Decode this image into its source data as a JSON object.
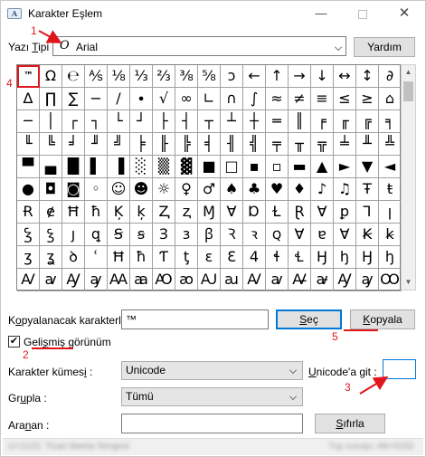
{
  "window": {
    "title": "Karakter Eşlem",
    "app_icon": "A"
  },
  "titlebar": {
    "minimize": "—",
    "close": "✕"
  },
  "font_row": {
    "label_pre": "Yazı ",
    "label_u": "T",
    "label_post": "ipi :",
    "value": "Arial",
    "font_icon": "O",
    "help": "Yardım"
  },
  "grid": {
    "selected": "™",
    "rows": [
      [
        "™",
        "Ω",
        "℮",
        "⅍",
        "⅛",
        "⅓",
        "⅔",
        "⅜",
        "⅝",
        "ↄ",
        "←",
        "↑",
        "→",
        "↓",
        "↔",
        "↕",
        "∂"
      ],
      [
        "∆",
        "∏",
        "∑",
        "−",
        "∕",
        "∙",
        "√",
        "∞",
        "∟",
        "∩",
        "∫",
        "≈",
        "≠",
        "≡",
        "≤",
        "≥",
        "⌂"
      ],
      [
        "─",
        "│",
        "┌",
        "┐",
        "└",
        "┘",
        "├",
        "┤",
        "┬",
        "┴",
        "┼",
        "═",
        "║",
        "╒",
        "╓",
        "╔",
        "╕"
      ],
      [
        "╙",
        "╚",
        "╛",
        "╜",
        "╝",
        "╞",
        "╟",
        "╠",
        "╡",
        "╢",
        "╣",
        "╤",
        "╥",
        "╦",
        "╧",
        "╨",
        "╩"
      ],
      [
        "▀",
        "▄",
        "█",
        "▌",
        "▐",
        "░",
        "▒",
        "▓",
        "■",
        "□",
        "▪",
        "▫",
        "▬",
        "▲",
        "►",
        "▼",
        "◄"
      ],
      [
        "●",
        "◘",
        "◙",
        "◦",
        "☺",
        "☻",
        "☼",
        "♀",
        "♂",
        "♠",
        "♣",
        "♥",
        "♦",
        "♪",
        "♫",
        "Ŧ",
        "ŧ"
      ],
      [
        "Ɍ",
        "ɇ",
        "Ħ",
        "ħ",
        "Ķ",
        "ķ",
        "Ⱬ",
        "ⱬ",
        "Ɱ",
        "Ɐ",
        "Ɒ",
        "Ɫ",
        "Ɽ",
        "Ɐ",
        "ꝑ",
        "Ꞁ",
        "ꞁ"
      ],
      [
        "Ꝣ",
        "ꝣ",
        "ȷ",
        "ꝗ",
        "Ꞩ",
        "ꞩ",
        "Ɜ",
        "ɜ",
        "ꞵ",
        "Ꝛ",
        "ꝛ",
        "ꞯ",
        "Ɐ",
        "ɐ",
        "Ɐ",
        "Ꞣ",
        "ꞣ"
      ],
      [
        "ʒ",
        "ʓ",
        "ꝺ",
        "ʿ",
        "Ħ",
        "ħ",
        "Ƭ",
        "ƫ",
        "ɛ",
        "Ɛ",
        "4",
        "ɬ",
        "Ɬ",
        "Ꜧ",
        "ꜧ",
        "Ꜧ",
        "ꜧ"
      ],
      [
        "Ꜹ",
        "ꜹ",
        "Ꜽ",
        "ꜽ",
        "Ꜳ",
        "ꜳ",
        "Ꜵ",
        "ꜵ",
        "Ꜷ",
        "ꜷ",
        "Ꜹ",
        "ꜹ",
        "Ꜻ",
        "ꜻ",
        "Ꜽ",
        "ꜽ",
        "Ꝏ"
      ]
    ]
  },
  "copy_row": {
    "label_pre": "K",
    "label_u": "o",
    "label_post": "pyalanacak karakterler :",
    "value": "™",
    "select_pre": "",
    "select_u": "S",
    "select_post": "eç",
    "copy_pre": "",
    "copy_u": "K",
    "copy_post": "opyala"
  },
  "advanced": {
    "checked": "✔",
    "label_pre": "Geli",
    "label_u": "ş",
    "label_post": "miş görünüm"
  },
  "charset": {
    "label_pre": "Karakter kümes",
    "label_u": "i",
    "label_post": " :",
    "value": "Unicode"
  },
  "goto": {
    "label_pre": "",
    "label_u": "U",
    "label_post": "nicode'a git :",
    "value": ""
  },
  "group": {
    "label_pre": "Gr",
    "label_u": "u",
    "label_post": "pla :",
    "value": "Tümü"
  },
  "search": {
    "label_pre": "Ara",
    "label_u": "n",
    "label_post": "an :",
    "value": "",
    "reset_pre": "",
    "reset_u": "S",
    "reset_post": "ıfırla"
  },
  "status": {
    "left": "U+2122: Ticari Marka Simgesi",
    "right": "Tuş vuruşu: Alt+0153"
  },
  "annotations": {
    "n1": "1",
    "n2": "2",
    "n3": "3",
    "n4": "4",
    "n5": "5",
    "color": "#e0161c"
  }
}
